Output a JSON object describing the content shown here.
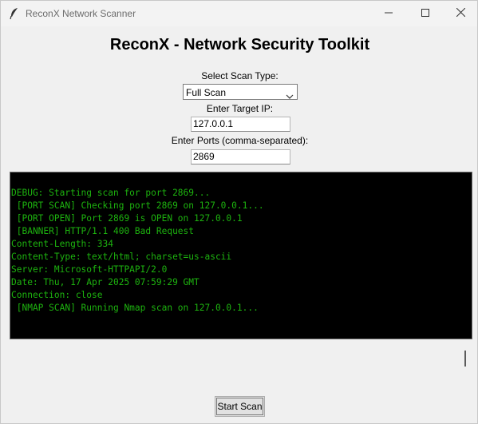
{
  "window": {
    "title": "ReconX Network Scanner"
  },
  "header": {
    "title": "ReconX - Network Security Toolkit"
  },
  "form": {
    "scan_type_label": "Select Scan Type:",
    "scan_type_value": "Full Scan",
    "target_ip_label": "Enter Target IP:",
    "target_ip_value": "127.0.0.1",
    "ports_label": "Enter Ports (comma-separated):",
    "ports_value": "2869"
  },
  "console": {
    "lines": [
      "DEBUG: Starting scan for port 2869...",
      " [PORT SCAN] Checking port 2869 on 127.0.0.1...",
      " [PORT OPEN] Port 2869 is OPEN on 127.0.0.1",
      " [BANNER] HTTP/1.1 400 Bad Request",
      "Content-Length: 334",
      "Content-Type: text/html; charset=us-ascii",
      "Server: Microsoft-HTTPAPI/2.0",
      "Date: Thu, 17 Apr 2025 07:59:29 GMT",
      "Connection: close",
      " [NMAP SCAN] Running Nmap scan on 127.0.0.1..."
    ],
    "text_color": "#1db30f",
    "background": "#000000"
  },
  "actions": {
    "start_label": "Start Scan"
  },
  "icons": {
    "app": "feather-icon",
    "minimize": "minimize-icon",
    "maximize": "maximize-icon",
    "close": "close-icon",
    "dropdown": "chevron-down-icon"
  }
}
